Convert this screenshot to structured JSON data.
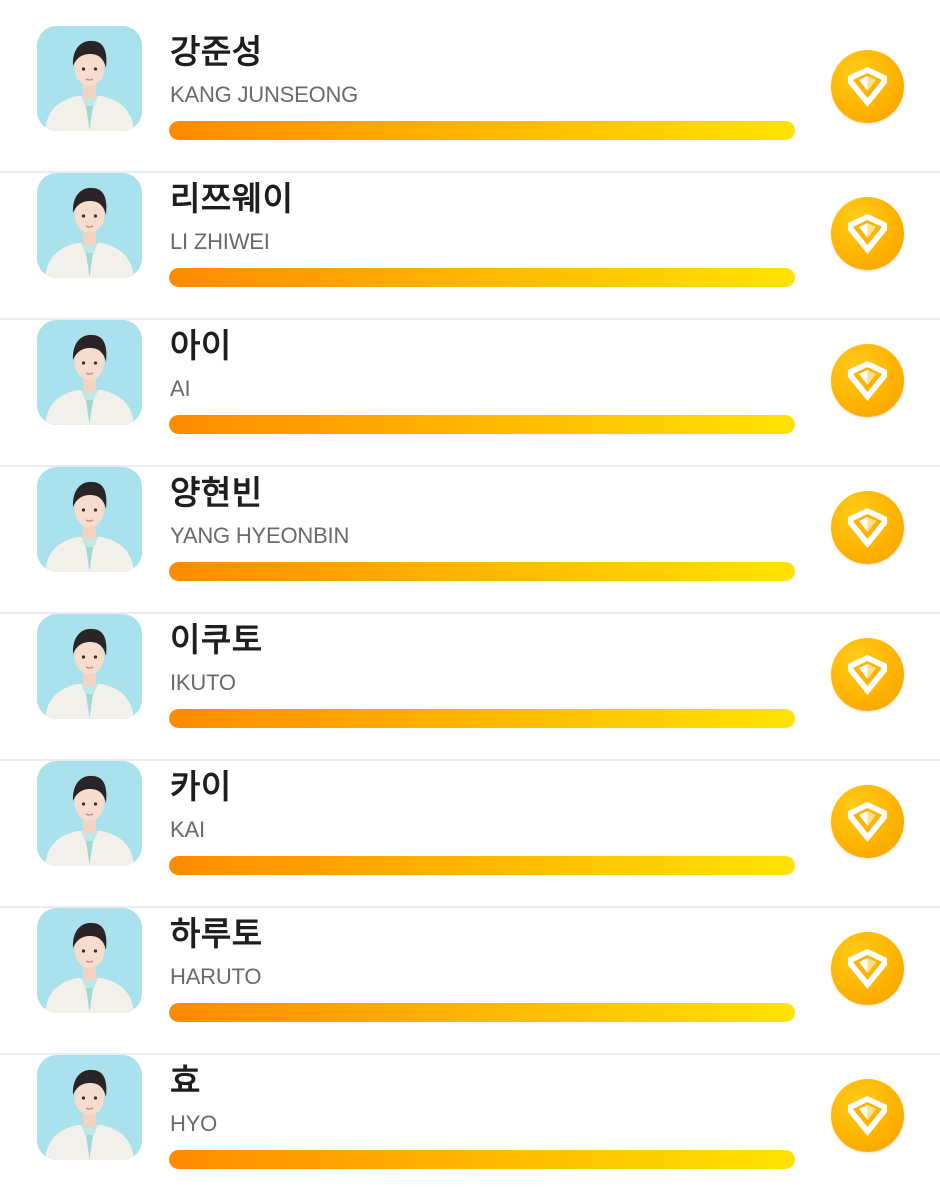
{
  "colors": {
    "avatar_bg": "#a9e1ec",
    "bar_start": "#ff8a00",
    "bar_end": "#ffe300",
    "vote_button": "#ffb300",
    "divider": "#ececf0"
  },
  "vote_icon": "heart-v-icon",
  "trainees": [
    {
      "name_ko": "강준성",
      "name_en": "KANG JUNSEONG",
      "vote_progress": 1.0
    },
    {
      "name_ko": "리쯔웨이",
      "name_en": "LI ZHIWEI",
      "vote_progress": 1.0
    },
    {
      "name_ko": "아이",
      "name_en": "AI",
      "vote_progress": 1.0
    },
    {
      "name_ko": "양현빈",
      "name_en": "YANG HYEONBIN",
      "vote_progress": 1.0
    },
    {
      "name_ko": "이쿠토",
      "name_en": "IKUTO",
      "vote_progress": 1.0
    },
    {
      "name_ko": "카이",
      "name_en": "KAI",
      "vote_progress": 1.0
    },
    {
      "name_ko": "하루토",
      "name_en": "HARUTO",
      "vote_progress": 1.0
    },
    {
      "name_ko": "효",
      "name_en": "HYO",
      "vote_progress": 1.0
    }
  ]
}
